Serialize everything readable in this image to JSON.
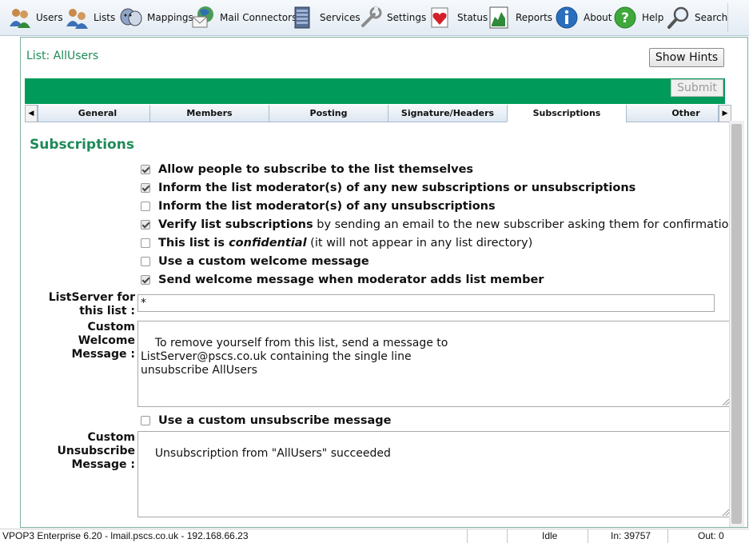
{
  "toolbar": {
    "items": [
      {
        "label": "Users",
        "icon": "users-icon"
      },
      {
        "label": "Lists",
        "icon": "lists-icon"
      },
      {
        "label": "Mappings",
        "icon": "mappings-icon"
      },
      {
        "label": "Mail Connectors",
        "icon": "mail-connectors-icon"
      },
      {
        "label": "Services",
        "icon": "services-icon"
      },
      {
        "label": "Settings",
        "icon": "settings-icon"
      },
      {
        "label": "Status",
        "icon": "status-icon"
      },
      {
        "label": "Reports",
        "icon": "reports-icon"
      },
      {
        "label": "About",
        "icon": "about-icon"
      },
      {
        "label": "Help",
        "icon": "help-icon"
      },
      {
        "label": "Search",
        "icon": "search-icon"
      }
    ]
  },
  "list_title": "List: AllUsers",
  "show_hints_label": "Show Hints",
  "submit_label": "Submit",
  "tabs": [
    {
      "label": "General"
    },
    {
      "label": "Members"
    },
    {
      "label": "Posting"
    },
    {
      "label": "Signature/Headers"
    },
    {
      "label": "Subscriptions",
      "active": true
    },
    {
      "label": "Other"
    }
  ],
  "section_title": "Subscriptions",
  "options": {
    "allow_subscribe": {
      "checked": true,
      "label": "Allow people to subscribe to the list themselves"
    },
    "inform_new": {
      "checked": true,
      "label": "Inform the list moderator(s) of any new subscriptions or unsubscriptions"
    },
    "inform_unsub": {
      "checked": false,
      "label": "Inform the list moderator(s) of any unsubscriptions"
    },
    "verify": {
      "checked": true,
      "label_bold": "Verify list subscriptions",
      "label_rest": " by sending an email to the new subscriber asking them for confirmation"
    },
    "confidential": {
      "checked": false,
      "label_bold": "This list is ",
      "label_italic": "confidential",
      "label_rest": " (it will not appear in any list directory)"
    },
    "custom_welcome": {
      "checked": false,
      "label": "Use a custom welcome message"
    },
    "send_welcome": {
      "checked": true,
      "label": "Send welcome message when moderator adds list member"
    },
    "custom_unsub": {
      "checked": false,
      "label": "Use a custom unsubscribe message"
    }
  },
  "fields": {
    "listserver": {
      "label_line1": "ListServer for",
      "label_line2": "this list :",
      "value": "*"
    },
    "welcome": {
      "label_line1": "Custom",
      "label_line2": "Welcome",
      "label_line3": "Message :",
      "value": "To remove yourself from this list, send a message to\nListServer@pscs.co.uk containing the single line\nunsubscribe AllUsers"
    },
    "unsubscribe": {
      "label_line1": "Custom",
      "label_line2": "Unsubscribe",
      "label_line3": "Message :",
      "value": "Unsubscription from \"AllUsers\" succeeded"
    }
  },
  "statusbar": {
    "app": "VPOP3 Enterprise 6.20 - lmail.pscs.co.uk - 192.168.66.23",
    "state": "Idle",
    "in": "In: 39757",
    "out": "Out: 0"
  },
  "colors": {
    "accent_green": "#009b5a",
    "title_green": "#1f8a58"
  }
}
